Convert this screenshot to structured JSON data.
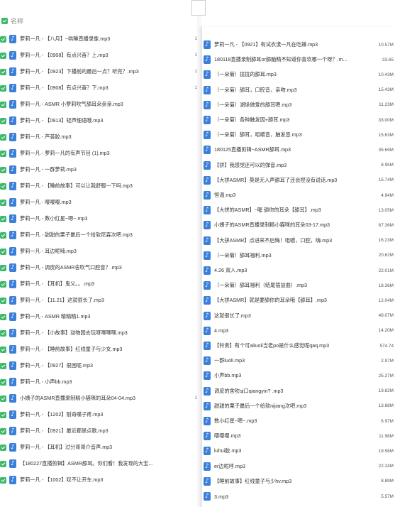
{
  "header": {
    "label": "名称"
  },
  "left_files": [
    {
      "name": "萝莉一凡 - 【八月】~哄睡直播录像.mp3",
      "tail": "1"
    },
    {
      "name": "萝莉一凡 - 【0908】有点兴奋？上.mp3",
      "tail": "1"
    },
    {
      "name": "萝莉一凡 - 【0923】下播前的最后一点？听完？.mp3",
      "tail": "1"
    },
    {
      "name": "萝莉一凡 - 【0908】有点兴奋？下.mp3",
      "tail": "1"
    },
    {
      "name": "萝莉一凡 - ASMR 小萝莉吹气舔耳朵亲亲.mp3",
      "tail": ""
    },
    {
      "name": "萝莉一凡 - 【0913】轻声细语哦.mp3",
      "tail": ""
    },
    {
      "name": "萝莉一凡 - 芦荟胶.mp3",
      "tail": ""
    },
    {
      "name": "萝莉一凡 - 萝莉一凡的有声节目 (1).mp3",
      "tail": ""
    },
    {
      "name": "萝莉一凡 - 一群萝莉.mp3",
      "tail": ""
    },
    {
      "name": "萝莉一凡 - 【睡前故事】可以让我舒服一下吗.mp3",
      "tail": ""
    },
    {
      "name": "萝莉一凡 - 嘤嘤嘤.mp3",
      "tail": ""
    },
    {
      "name": "萝莉一凡 - 数小红星~嗯~.mp3",
      "tail": ""
    },
    {
      "name": "萝莉一凡 - 甜甜的栗子最后一个给软尼森次吧.mp3",
      "tail": ""
    },
    {
      "name": "萝莉一凡 - 耳边呢喃.mp3",
      "tail": ""
    },
    {
      "name": "萝莉一凡 - 调皮的ASMR舍吹气口腔音？.mp3",
      "tail": ""
    },
    {
      "name": "萝莉一凡 - 【耳机】鬼父。。.mp3",
      "tail": ""
    },
    {
      "name": "萝莉一凡 - 【11.21】这就很长了.mp3",
      "tail": ""
    },
    {
      "name": "萝莉一凡 - ASMR 精精精1.mp3",
      "tail": ""
    },
    {
      "name": "萝莉一凡 - 【小故事】动物园去玩呀嘿嘿嘿.mp3",
      "tail": ""
    },
    {
      "name": "萝莉一凡 - 【睡前故事】红线童子与少女.mp3",
      "tail": ""
    },
    {
      "name": "萝莉一凡 - 【0927】很困呢.mp3",
      "tail": ""
    },
    {
      "name": "萝莉一凡 - 小声bb.mp3",
      "tail": ""
    },
    {
      "name": "小姨子的ASMR直播录制精小猫咪的耳朵04-04.mp3",
      "tail": "1"
    },
    {
      "name": "萝莉一凡 - 【1202】耐奇嘴子疼.mp3",
      "tail": ""
    },
    {
      "name": "萝莉一凡 - 【0921】最近都是点歌.mp3",
      "tail": ""
    },
    {
      "name": "萝莉一凡 - 【耳机】过分哥哥介音声.mp3",
      "tail": ""
    },
    {
      "name": "【180227直播剪辑】ASMR舔耳。你们看！我发现的大宝...",
      "tail": ""
    },
    {
      "name": "萝莉一凡 - 【1002】叹不让开车.mp3",
      "tail": ""
    }
  ],
  "right_files": [
    {
      "name": "萝莉一凡 - 【0921】有试衣漾一凡在吃辣.mp3",
      "size": "10.57M"
    },
    {
      "name": "180118直播录制舔耳or舔脑精不知道你喜欢哪一个呀？.m...",
      "size": "33.65"
    },
    {
      "name": "（一朵菊）拢拢的舔耳.mp3",
      "size": "10.43M"
    },
    {
      "name": "（一朵菊）舔耳，口腔音，亲吻.mp3",
      "size": "15.43M"
    },
    {
      "name": "（一朵菊）湖垛做爱的舔耳嗯.mp3",
      "size": "11.23M"
    },
    {
      "name": "（一朵菊）各种触发因+舔耳.mp3",
      "size": "33.00M"
    },
    {
      "name": "（一朵菊）舔耳，咀嚼音，触发音.mp3",
      "size": "15.63M"
    },
    {
      "name": "180125直播剪辑~ASMR舔耳.mp3",
      "size": "35.69M"
    },
    {
      "name": "【拼】我感觉还可以的弹音.mp3",
      "size": "8.95M"
    },
    {
      "name": "【大拼ASMR】莫是无人声舔耳了还会捏没有说话.mp3",
      "size": "15.74M"
    },
    {
      "name": "恒温.mp3",
      "size": "4.94M"
    },
    {
      "name": "【大拼的ASMR】~喔 舔你的耳朵【舔耳】.mp3",
      "size": "13.05M"
    },
    {
      "name": "小姨子的ASMR直播录制精小猫咪的耳朵03-17.mp3",
      "size": "67.36M"
    },
    {
      "name": "【大拼ASMR】点进来不后悔！咀嚼，口腔，嗨.mp3",
      "size": "16.23M"
    },
    {
      "name": "（一朵菊）舔耳福利.mp3",
      "size": "20.62M"
    },
    {
      "name": "4.26 双人.mp3",
      "size": "22.01M"
    },
    {
      "name": "（一朵菊）舔耳福利（结尾插益曲）.mp3",
      "size": "18.36M"
    },
    {
      "name": "【大拼ASMR】就是要舔你的耳朵哦【舔耳】.mp3",
      "size": "12.04M"
    },
    {
      "name": "这就很长了.mp3",
      "size": "49.07M"
    },
    {
      "name": "4.mp3",
      "size": "14.20M"
    },
    {
      "name": "【铃贵】有个可ailuoli当老po是什么感觉呢qaq.mp3",
      "size": "574.74"
    },
    {
      "name": "一群luoli.mp3",
      "size": "2.97M"
    },
    {
      "name": "小声bb.mp3",
      "size": "25.37M"
    },
    {
      "name": "调皮的舍吹qi口qiangyin? .mp3",
      "size": "19.82M"
    },
    {
      "name": "甜甜的栗子最后一个给软nijiang次吧.mp3",
      "size": "13.88M"
    },
    {
      "name": "数小红星~嗯~.mp3",
      "size": "6.97M"
    },
    {
      "name": "嘤嘤嘤.mp3",
      "size": "11.98M"
    },
    {
      "name": "luhui胶.mp3",
      "size": "19.58M"
    },
    {
      "name": "er边呢呼.mp3",
      "size": "22.24M"
    },
    {
      "name": "【睡前故事】红线童子与少hv.mp3",
      "size": "8.89M"
    },
    {
      "name": "3.mp3",
      "size": "5.57M"
    }
  ]
}
